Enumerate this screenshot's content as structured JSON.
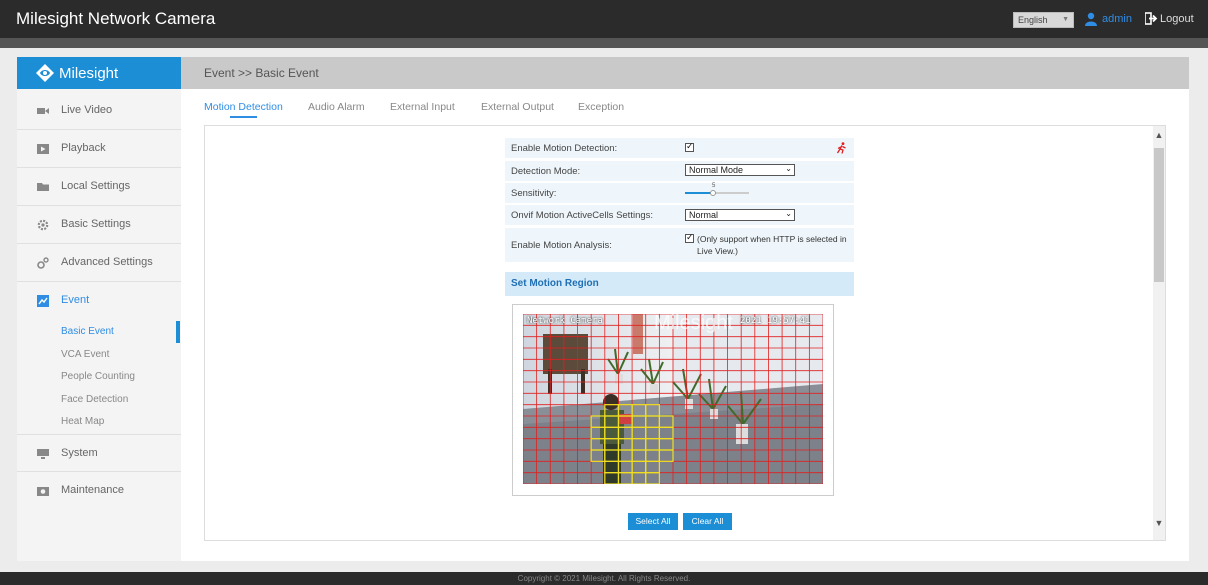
{
  "header": {
    "app_title": "Milesight Network Camera",
    "language": "English",
    "user": "admin",
    "logout": "Logout"
  },
  "sidebar": {
    "logo_text": "Milesight",
    "items": [
      {
        "label": "Live Video",
        "icon": "video-camera-icon"
      },
      {
        "label": "Playback",
        "icon": "play-icon"
      },
      {
        "label": "Local Settings",
        "icon": "folder-icon"
      },
      {
        "label": "Basic Settings",
        "icon": "gear-icon"
      },
      {
        "label": "Advanced Settings",
        "icon": "gears-icon"
      },
      {
        "label": "Event",
        "icon": "event-icon"
      },
      {
        "label": "System",
        "icon": "monitor-icon"
      },
      {
        "label": "Maintenance",
        "icon": "camera-icon"
      }
    ],
    "event_subitems": [
      "Basic Event",
      "VCA Event",
      "People Counting",
      "Face Detection",
      "Heat Map"
    ],
    "active_item": "Event",
    "active_subitem": "Basic Event"
  },
  "breadcrumb": "Event >> Basic Event",
  "tabs": [
    "Motion Detection",
    "Audio Alarm",
    "External Input",
    "External Output",
    "Exception"
  ],
  "active_tab": "Motion Detection",
  "form": {
    "enable_motion_label": "Enable Motion Detection:",
    "enable_motion_checked": true,
    "detection_mode_label": "Detection Mode:",
    "detection_mode_value": "Normal Mode",
    "sensitivity_label": "Sensitivity:",
    "sensitivity_value": "5",
    "onvif_label": "Onvif Motion ActiveCells Settings:",
    "onvif_value": "Normal",
    "analysis_label": "Enable Motion Analysis:",
    "analysis_checked": true,
    "analysis_note": "(Only support when HTTP is selected in Live View.)"
  },
  "motion_region": {
    "title": "Set Motion Region",
    "osd_left": "Network Camera",
    "osd_right": "2021 19:57:41",
    "watermark": "Milesight"
  },
  "buttons": {
    "select_all": "Select All",
    "clear_all": "Clear All"
  },
  "footer": "Copyright © 2021 Milesight. All Rights Reserved.",
  "colors": {
    "accent": "#1b8ed6",
    "link": "#2f8de4",
    "grid": "#e02020",
    "selected_grid": "#f0e020"
  }
}
